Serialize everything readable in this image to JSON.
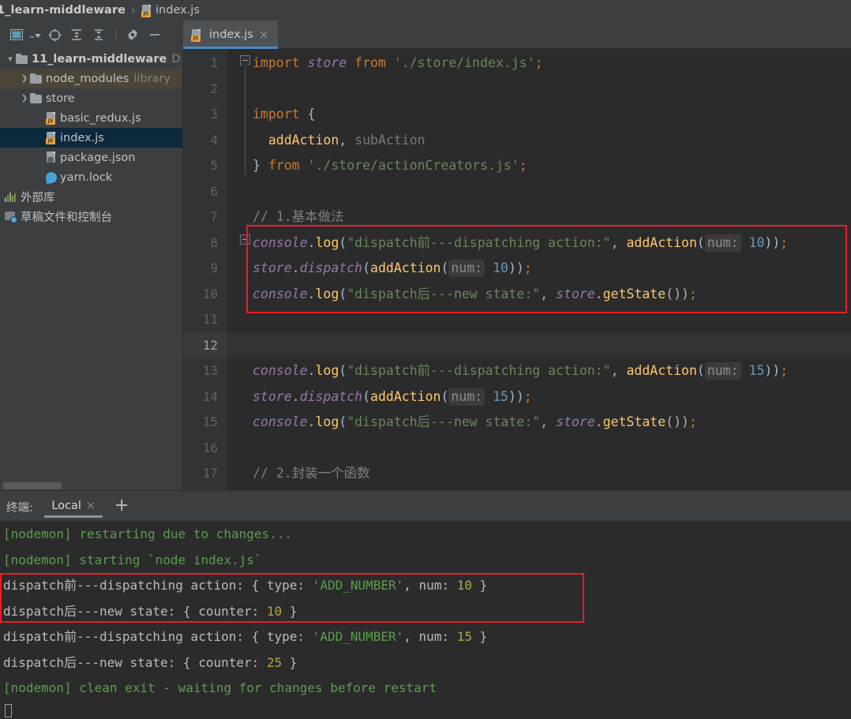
{
  "breadcrumb": {
    "project": "1_learn-middleware",
    "separator": "›",
    "file": "index.js",
    "file_icon": "js-file-icon"
  },
  "toolbar": {
    "icons": [
      {
        "name": "select-opened-file-icon",
        "glyph": "window"
      },
      {
        "name": "dropdown-arrow-icon",
        "glyph": "..▾"
      },
      {
        "name": "scroll-from-source-icon",
        "glyph": "crosshair"
      },
      {
        "name": "expand-all-icon",
        "glyph": "expand"
      },
      {
        "name": "collapse-all-icon",
        "glyph": "collapse"
      },
      {
        "name": "settings-gear-icon",
        "glyph": "gear"
      },
      {
        "name": "hide-panel-icon",
        "glyph": "minus"
      }
    ]
  },
  "editor_tabs": [
    {
      "label": "index.js",
      "icon": "js-file-icon",
      "close": "×",
      "active": true
    }
  ],
  "tree": {
    "items": [
      {
        "indent": 0,
        "arrow": "⌄",
        "icon": "folder-icon",
        "label": "11_learn-middleware",
        "dim": "D:",
        "bold": true,
        "state": "normal"
      },
      {
        "indent": 1,
        "arrow": "›",
        "icon": "folder-icon",
        "label": "node_modules",
        "dim": "library",
        "bold": false,
        "state": "hover"
      },
      {
        "indent": 1,
        "arrow": "›",
        "icon": "folder-icon",
        "label": "store",
        "dim": "",
        "bold": false,
        "state": "normal"
      },
      {
        "indent": 2,
        "arrow": "",
        "icon": "js-file-icon",
        "label": "basic_redux.js",
        "dim": "",
        "bold": false,
        "state": "normal"
      },
      {
        "indent": 2,
        "arrow": "",
        "icon": "js-file-icon",
        "label": "index.js",
        "dim": "",
        "bold": false,
        "state": "selected"
      },
      {
        "indent": 2,
        "arrow": "",
        "icon": "json-file-icon",
        "label": "package.json",
        "dim": "",
        "bold": false,
        "state": "normal"
      },
      {
        "indent": 2,
        "arrow": "",
        "icon": "yarn-lock-icon",
        "label": "yarn.lock",
        "dim": "",
        "bold": false,
        "state": "normal"
      },
      {
        "indent": 0,
        "arrow": "",
        "icon": "external-libraries-icon",
        "label": "外部库",
        "dim": "",
        "bold": false,
        "state": "normal"
      },
      {
        "indent": 0,
        "arrow": "",
        "icon": "scratches-console-icon",
        "label": "草稿文件和控制台",
        "dim": "",
        "bold": false,
        "state": "normal"
      }
    ]
  },
  "editor": {
    "current_line": 12,
    "line_numbers": [
      1,
      2,
      3,
      4,
      5,
      6,
      7,
      8,
      9,
      10,
      11,
      12,
      13,
      14,
      15,
      16,
      17
    ],
    "lines": [
      {
        "n": 1,
        "tokens": [
          {
            "t": "import ",
            "c": "kw"
          },
          {
            "t": "store",
            "c": "obj"
          },
          {
            "t": " from ",
            "c": "kw"
          },
          {
            "t": "'./store/index.js'",
            "c": "str"
          },
          {
            "t": ";",
            "c": "semi"
          }
        ]
      },
      {
        "n": 2,
        "tokens": []
      },
      {
        "n": 3,
        "tokens": [
          {
            "t": "import ",
            "c": "kw"
          },
          {
            "t": "{",
            "c": "punc"
          }
        ]
      },
      {
        "n": 4,
        "tokens": [
          {
            "t": "  ",
            "c": "punc"
          },
          {
            "t": "addAction",
            "c": "fn"
          },
          {
            "t": ", ",
            "c": "punc"
          },
          {
            "t": "subAction",
            "c": "dim"
          }
        ]
      },
      {
        "n": 5,
        "tokens": [
          {
            "t": "}",
            "c": "punc"
          },
          {
            "t": " from ",
            "c": "kw"
          },
          {
            "t": "'./store/actionCreators.js'",
            "c": "str"
          },
          {
            "t": ";",
            "c": "semi"
          }
        ]
      },
      {
        "n": 6,
        "tokens": []
      },
      {
        "n": 7,
        "tokens": [
          {
            "t": "// 1.基本做法",
            "c": "cmt"
          }
        ]
      },
      {
        "n": 8,
        "tokens": [
          {
            "t": "console",
            "c": "obj"
          },
          {
            "t": ".",
            "c": "punc"
          },
          {
            "t": "log",
            "c": "fn"
          },
          {
            "t": "(",
            "c": "paren"
          },
          {
            "t": "\"dispatch前---dispatching action:\"",
            "c": "str"
          },
          {
            "t": ", ",
            "c": "punc"
          },
          {
            "t": "addAction",
            "c": "fn"
          },
          {
            "t": "(",
            "c": "paren"
          },
          {
            "t": "num:",
            "c": "param"
          },
          {
            "t": " ",
            "c": "punc"
          },
          {
            "t": "10",
            "c": "num"
          },
          {
            "t": "))",
            "c": "paren"
          },
          {
            "t": ";",
            "c": "semi"
          }
        ]
      },
      {
        "n": 9,
        "tokens": [
          {
            "t": "store",
            "c": "obj"
          },
          {
            "t": ".",
            "c": "punc"
          },
          {
            "t": "dispatch",
            "c": "obj"
          },
          {
            "t": "(",
            "c": "paren"
          },
          {
            "t": "addAction",
            "c": "fn"
          },
          {
            "t": "(",
            "c": "paren"
          },
          {
            "t": "num:",
            "c": "param"
          },
          {
            "t": " ",
            "c": "punc"
          },
          {
            "t": "10",
            "c": "num"
          },
          {
            "t": "))",
            "c": "paren"
          },
          {
            "t": ";",
            "c": "semi"
          }
        ]
      },
      {
        "n": 10,
        "tokens": [
          {
            "t": "console",
            "c": "obj"
          },
          {
            "t": ".",
            "c": "punc"
          },
          {
            "t": "log",
            "c": "fn"
          },
          {
            "t": "(",
            "c": "paren"
          },
          {
            "t": "\"dispatch后---new state:\"",
            "c": "str"
          },
          {
            "t": ", ",
            "c": "punc"
          },
          {
            "t": "store",
            "c": "obj"
          },
          {
            "t": ".",
            "c": "punc"
          },
          {
            "t": "getState",
            "c": "fn"
          },
          {
            "t": "())",
            "c": "paren"
          },
          {
            "t": ";",
            "c": "semi"
          }
        ]
      },
      {
        "n": 11,
        "tokens": []
      },
      {
        "n": 12,
        "tokens": []
      },
      {
        "n": 13,
        "tokens": [
          {
            "t": "console",
            "c": "obj"
          },
          {
            "t": ".",
            "c": "punc"
          },
          {
            "t": "log",
            "c": "fn"
          },
          {
            "t": "(",
            "c": "paren"
          },
          {
            "t": "\"dispatch前---dispatching action:\"",
            "c": "str"
          },
          {
            "t": ", ",
            "c": "punc"
          },
          {
            "t": "addAction",
            "c": "fn"
          },
          {
            "t": "(",
            "c": "paren"
          },
          {
            "t": "num:",
            "c": "param"
          },
          {
            "t": " ",
            "c": "punc"
          },
          {
            "t": "15",
            "c": "num"
          },
          {
            "t": "))",
            "c": "paren"
          },
          {
            "t": ";",
            "c": "semi"
          }
        ]
      },
      {
        "n": 14,
        "tokens": [
          {
            "t": "store",
            "c": "obj"
          },
          {
            "t": ".",
            "c": "punc"
          },
          {
            "t": "dispatch",
            "c": "obj"
          },
          {
            "t": "(",
            "c": "paren"
          },
          {
            "t": "addAction",
            "c": "fn"
          },
          {
            "t": "(",
            "c": "paren"
          },
          {
            "t": "num:",
            "c": "param"
          },
          {
            "t": " ",
            "c": "punc"
          },
          {
            "t": "15",
            "c": "num"
          },
          {
            "t": "))",
            "c": "paren"
          },
          {
            "t": ";",
            "c": "semi"
          }
        ]
      },
      {
        "n": 15,
        "tokens": [
          {
            "t": "console",
            "c": "obj"
          },
          {
            "t": ".",
            "c": "punc"
          },
          {
            "t": "log",
            "c": "fn"
          },
          {
            "t": "(",
            "c": "paren"
          },
          {
            "t": "\"dispatch后---new state:\"",
            "c": "str"
          },
          {
            "t": ", ",
            "c": "punc"
          },
          {
            "t": "store",
            "c": "obj"
          },
          {
            "t": ".",
            "c": "punc"
          },
          {
            "t": "getState",
            "c": "fn"
          },
          {
            "t": "())",
            "c": "paren"
          },
          {
            "t": ";",
            "c": "semi"
          }
        ]
      },
      {
        "n": 16,
        "tokens": []
      },
      {
        "n": 17,
        "tokens": [
          {
            "t": "// 2.封装一个函数",
            "c": "cmt"
          }
        ]
      }
    ],
    "highlight_box_color": "#ee1c25"
  },
  "terminal": {
    "title": "终端:",
    "tab_label": "Local",
    "tab_close": "×",
    "add_label": "+",
    "highlight_box_color": "#ee1c25",
    "lines": [
      {
        "segs": [
          {
            "t": "[nodemon] restarting due to changes...",
            "c": "tg"
          }
        ]
      },
      {
        "segs": [
          {
            "t": "[nodemon] starting `node index.js`",
            "c": "tg"
          }
        ]
      },
      {
        "segs": [
          {
            "t": "dispatch前---dispatching action: { type: ",
            "c": "tw"
          },
          {
            "t": "'ADD_NUMBER'",
            "c": "tgr"
          },
          {
            "t": ", num: ",
            "c": "tw"
          },
          {
            "t": "10",
            "c": "ty"
          },
          {
            "t": " }",
            "c": "tw"
          }
        ]
      },
      {
        "segs": [
          {
            "t": "dispatch后---new state: { counter: ",
            "c": "tw"
          },
          {
            "t": "10",
            "c": "ty"
          },
          {
            "t": " }",
            "c": "tw"
          }
        ]
      },
      {
        "segs": [
          {
            "t": "dispatch前---dispatching action: { type: ",
            "c": "tw"
          },
          {
            "t": "'ADD_NUMBER'",
            "c": "tgr"
          },
          {
            "t": ", num: ",
            "c": "tw"
          },
          {
            "t": "15",
            "c": "ty"
          },
          {
            "t": " }",
            "c": "tw"
          }
        ]
      },
      {
        "segs": [
          {
            "t": "dispatch后---new state: { counter: ",
            "c": "tw"
          },
          {
            "t": "25",
            "c": "ty"
          },
          {
            "t": " }",
            "c": "tw"
          }
        ]
      },
      {
        "segs": [
          {
            "t": "[nodemon] clean exit - waiting for changes before restart",
            "c": "tg"
          }
        ]
      }
    ]
  },
  "colors": {
    "panel_bg": "#3c3f41",
    "editor_bg": "#2b2b2b",
    "gutter_bg": "#313335",
    "selection_bg": "#0d293e",
    "accent": "#4a88c7",
    "highlight_red": "#ee1c25",
    "terminal_green": "#5b9e4e",
    "terminal_yellow": "#b5a642"
  }
}
